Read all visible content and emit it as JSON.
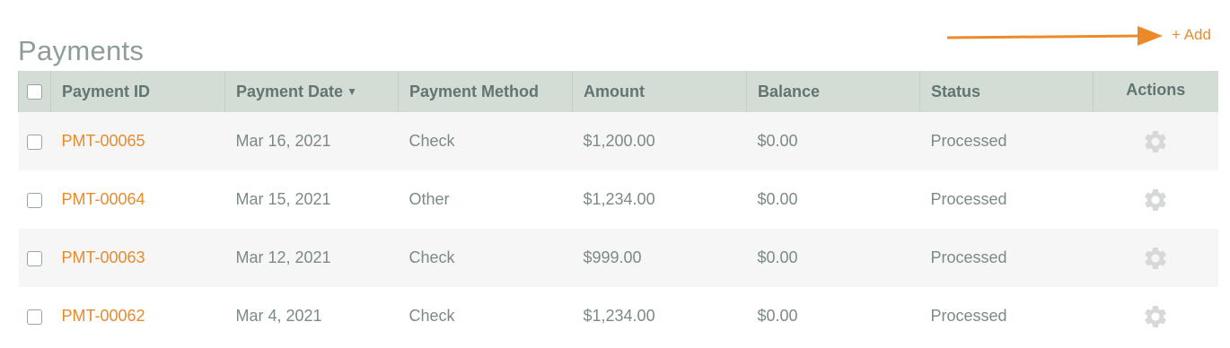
{
  "page": {
    "title": "Payments"
  },
  "actions": {
    "add_label": "+ Add"
  },
  "colors": {
    "accent": "#ec8a2a",
    "header_bg": "#d3ddd6",
    "title": "#8e9d9a"
  },
  "table": {
    "columns": {
      "payment_id": "Payment ID",
      "payment_date": "Payment Date",
      "payment_method": "Payment Method",
      "amount": "Amount",
      "balance": "Balance",
      "status": "Status",
      "actions": "Actions"
    },
    "sort": {
      "column": "payment_date",
      "direction": "descending",
      "icon": "caret-down-icon"
    },
    "rows": [
      {
        "id": "PMT-00065",
        "date": "Mar 16, 2021",
        "method": "Check",
        "amount": "$1,200.00",
        "balance": "$0.00",
        "status": "Processed",
        "action_icon": "gear-icon"
      },
      {
        "id": "PMT-00064",
        "date": "Mar 15, 2021",
        "method": "Other",
        "amount": "$1,234.00",
        "balance": "$0.00",
        "status": "Processed",
        "action_icon": "gear-icon"
      },
      {
        "id": "PMT-00063",
        "date": "Mar 12, 2021",
        "method": "Check",
        "amount": "$999.00",
        "balance": "$0.00",
        "status": "Processed",
        "action_icon": "gear-icon"
      },
      {
        "id": "PMT-00062",
        "date": "Mar 4, 2021",
        "method": "Check",
        "amount": "$1,234.00",
        "balance": "$0.00",
        "status": "Processed",
        "action_icon": "gear-icon"
      }
    ]
  }
}
